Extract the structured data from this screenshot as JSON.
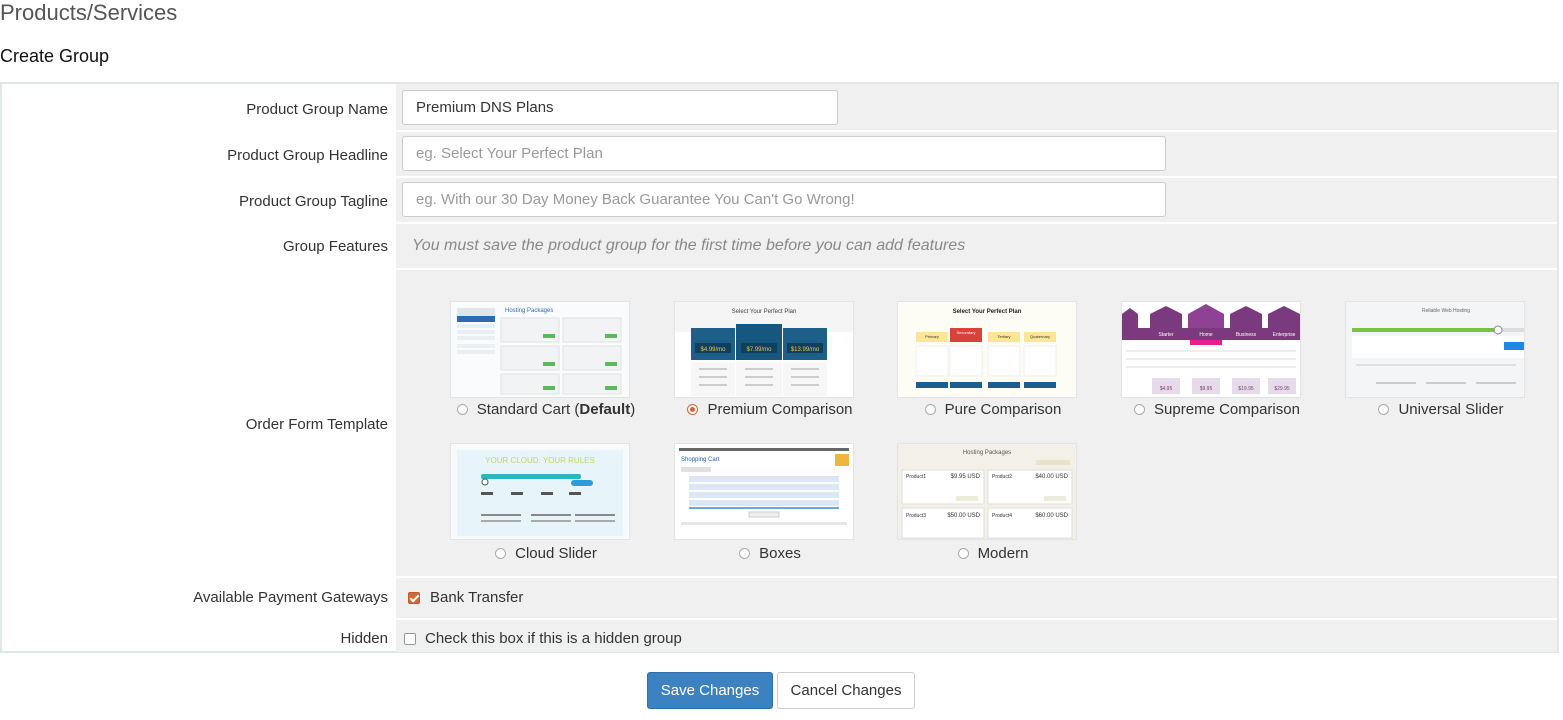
{
  "page": {
    "title": "Products/Services",
    "subtitle": "Create Group"
  },
  "form": {
    "group_name": {
      "label": "Product Group Name",
      "value": "Premium DNS Plans"
    },
    "headline": {
      "label": "Product Group Headline",
      "placeholder": "eg. Select Your Perfect Plan"
    },
    "tagline": {
      "label": "Product Group Tagline",
      "placeholder": "eg. With our 30 Day Money Back Guarantee You Can't Go Wrong!"
    },
    "features": {
      "label": "Group Features",
      "note": "You must save the product group for the first time before you can add features"
    },
    "order_form": {
      "label": "Order Form Template",
      "default_suffix": "Default",
      "selected": "Premium Comparison",
      "templates": [
        {
          "name": "Standard Cart",
          "thumb_title": "Hosting Packages"
        },
        {
          "name": "Premium Comparison",
          "thumb_title": "Select Your Perfect Plan",
          "prices": [
            "$4.99/mo",
            "$7.99/mo",
            "$13.99/mo"
          ]
        },
        {
          "name": "Pure Comparison",
          "thumb_title": "Select Your Perfect Plan",
          "columns": [
            "Primary",
            "Secondary",
            "Tertiary",
            "Quaternary"
          ]
        },
        {
          "name": "Supreme Comparison",
          "columns": [
            "Starter",
            "Home",
            "Business",
            "Enterprise"
          ],
          "prices": [
            "$4.95",
            "$9.95",
            "$19.95",
            "$29.95"
          ]
        },
        {
          "name": "Universal Slider",
          "thumb_title": "Reliable Web Hosting"
        },
        {
          "name": "Cloud Slider",
          "thumb_title": "YOUR CLOUD. YOUR RULES"
        },
        {
          "name": "Boxes",
          "thumb_title": "Shopping Cart"
        },
        {
          "name": "Modern",
          "thumb_title": "Hosting Packages",
          "products": [
            "Product1",
            "Product2",
            "Product3",
            "Product4"
          ],
          "prices": [
            "$9.95 USD",
            "$40.00 USD",
            "$50.00 USD",
            "$60.00 USD"
          ]
        }
      ]
    },
    "gateways": {
      "label": "Available Payment Gateways",
      "option": "Bank Transfer",
      "checked": true
    },
    "hidden": {
      "label": "Hidden",
      "option": "Check this box if this is a hidden group",
      "checked": false
    }
  },
  "buttons": {
    "save": "Save Changes",
    "cancel": "Cancel Changes"
  },
  "colors": {
    "primary": "#3d82c0",
    "accent": "#d9623a",
    "field_bg": "#f0f0f0",
    "border": "#dfe8e4"
  }
}
